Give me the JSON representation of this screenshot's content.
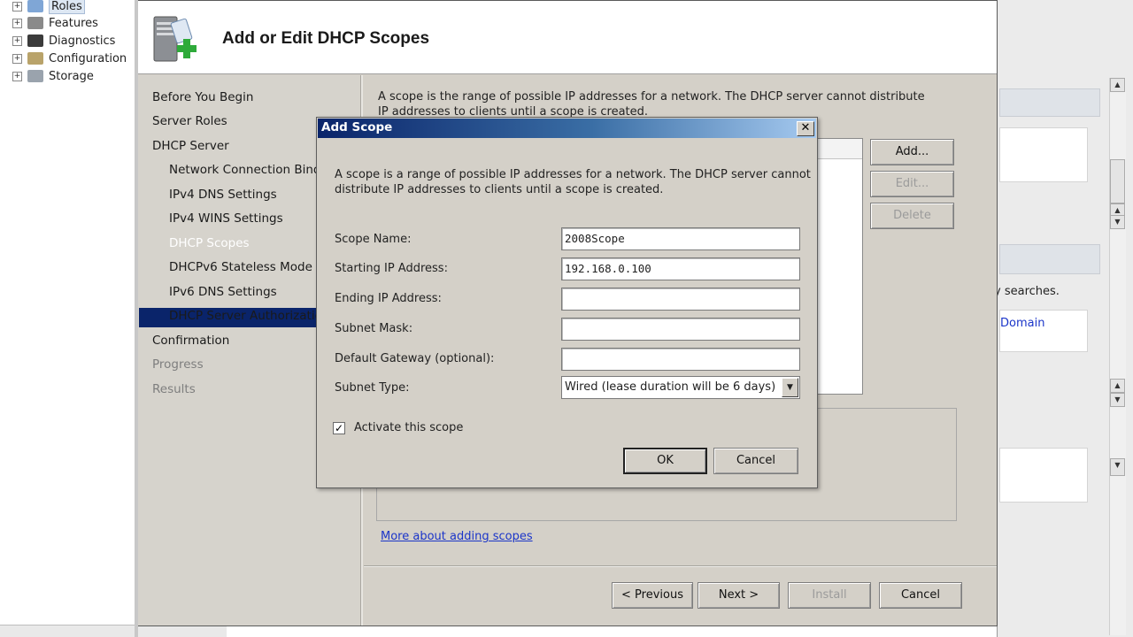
{
  "tree": {
    "items": [
      {
        "label": "Roles",
        "icon": "roles-icon"
      },
      {
        "label": "Features",
        "icon": "features-icon"
      },
      {
        "label": "Diagnostics",
        "icon": "diagnostics-icon"
      },
      {
        "label": "Configuration",
        "icon": "configuration-icon"
      },
      {
        "label": "Storage",
        "icon": "storage-icon"
      }
    ]
  },
  "background_panel": {
    "searches_text": "y searches.",
    "domain_link": "Domain"
  },
  "wizard": {
    "title": "Add or Edit DHCP Scopes",
    "nav": [
      {
        "label": "Before You Begin"
      },
      {
        "label": "Server Roles"
      },
      {
        "label": "DHCP Server"
      },
      {
        "label": "Network Connection Binding"
      },
      {
        "label": "IPv4 DNS Settings"
      },
      {
        "label": "IPv4 WINS Settings"
      },
      {
        "label": "DHCP Scopes"
      },
      {
        "label": "DHCPv6 Stateless Mode"
      },
      {
        "label": "IPv6 DNS Settings"
      },
      {
        "label": "DHCP Server Authorization"
      },
      {
        "label": "Confirmation"
      },
      {
        "label": "Progress"
      },
      {
        "label": "Results"
      }
    ],
    "description": "A scope is the range of possible IP addresses for a network. The DHCP server cannot distribute IP addresses to clients until a scope is created.",
    "buttons": {
      "add": "Add...",
      "edit": "Edit...",
      "delete": "Delete"
    },
    "more_link": "More about adding scopes",
    "footer": {
      "previous": "< Previous",
      "next": "Next >",
      "install": "Install",
      "cancel": "Cancel"
    }
  },
  "dialog": {
    "title": "Add Scope",
    "close": "✕",
    "description": "A scope is a range of possible IP addresses for a network. The DHCP server cannot distribute IP addresses to clients until a scope is created.",
    "fields": {
      "scope_name": {
        "label": "Scope Name:",
        "value": "2008Scope"
      },
      "start_ip": {
        "label": "Starting IP Address:",
        "value": "192.168.0.100"
      },
      "end_ip": {
        "label": "Ending IP Address:",
        "value": ""
      },
      "subnet_mask": {
        "label": "Subnet Mask:",
        "value": ""
      },
      "gateway": {
        "label": "Default Gateway (optional):",
        "value": ""
      },
      "subnet_type": {
        "label": "Subnet Type:",
        "value": "Wired (lease duration will be 6 days)"
      }
    },
    "activate_label": "Activate this scope",
    "activate_checked": true,
    "ok": "OK",
    "cancel": "Cancel"
  },
  "colors": {
    "selection": "#0a246a",
    "dialog_titlebar_start": "#0a246a",
    "dialog_titlebar_end": "#a6caf0",
    "link": "#1b35c9",
    "window_face": "#d4d0c8"
  }
}
